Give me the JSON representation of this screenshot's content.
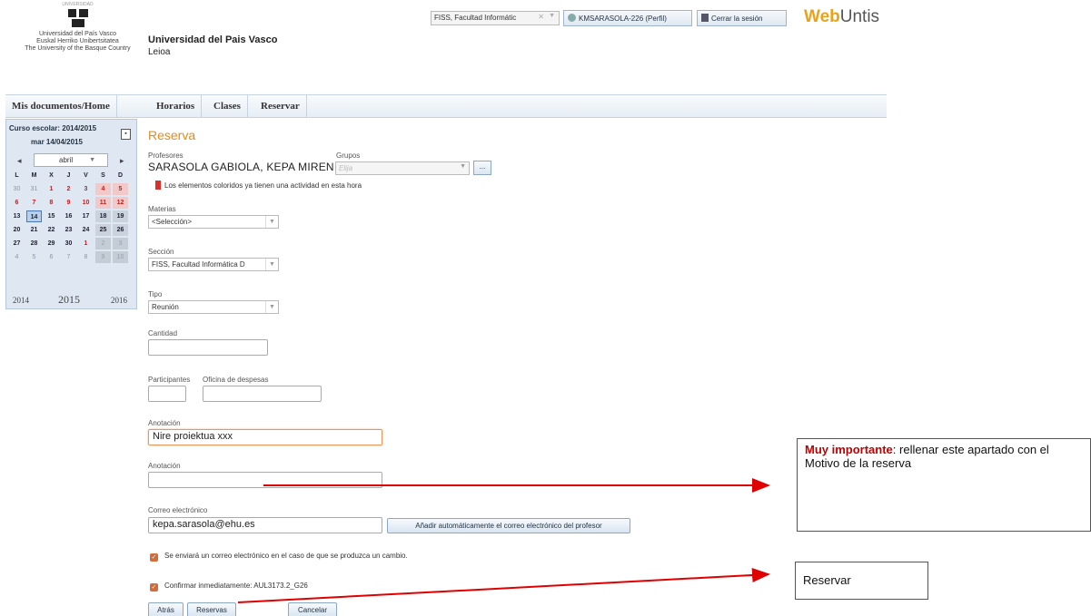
{
  "header": {
    "logo_top_text": "UNIVERSIDAD",
    "logo_lines": [
      "Universidad del País Vasco",
      "Euskal Herriko Unibertsitatea",
      "The University of the Basque Country"
    ],
    "university_name": "Universidad del Pais Vasco",
    "city": "Leioa",
    "school_select": "FISS, Facultad Informátic",
    "profile_button": "KMSARASOLA-226 (Perfil)",
    "logout_button": "Cerrar la sesión",
    "brand_web": "Web",
    "brand_untis": "Untis"
  },
  "menu": [
    "Mis documentos/Home",
    "Horarios",
    "Clases",
    "Reservar"
  ],
  "calendar": {
    "school_year": "Curso escolar: 2014/2015",
    "current_date": "mar 14/04/2015",
    "month": "abril",
    "weekdays": [
      "L",
      "M",
      "X",
      "J",
      "V",
      "S",
      "D"
    ],
    "weeks": [
      [
        "30",
        "31",
        "1",
        "2",
        "3",
        "4",
        "5"
      ],
      [
        "6",
        "7",
        "8",
        "9",
        "10",
        "11",
        "12"
      ],
      [
        "13",
        "14",
        "15",
        "16",
        "17",
        "18",
        "19"
      ],
      [
        "20",
        "21",
        "22",
        "23",
        "24",
        "25",
        "26"
      ],
      [
        "27",
        "28",
        "29",
        "30",
        "1",
        "2",
        "3"
      ],
      [
        "4",
        "5",
        "6",
        "7",
        "8",
        "9",
        "10"
      ]
    ],
    "years": [
      "2014",
      "2015",
      "2016"
    ]
  },
  "form": {
    "title": "Reserva",
    "teachers_label": "Profesores",
    "teacher_value": "SARASOLA GABIOLA, KEPA MIREN",
    "groups_label": "Grupos",
    "groups_placeholder": "Elija",
    "more_button": "...",
    "legend_text": "Los elementos coloridos ya tienen una actividad en esta hora",
    "subjects_label": "Materias",
    "subjects_value": "<Selección>",
    "section_label": "Sección",
    "section_value": "FISS, Facultad Informática D",
    "type_label": "Tipo",
    "type_value": "Reunión",
    "quantity_label": "Cantidad",
    "quantity_value": "",
    "participants_label": "Participantes",
    "participants_value": "",
    "expense_office_label": "Oficina de despesas",
    "expense_office_value": "",
    "annotation1_label": "Anotación",
    "annotation1_value": "Nire proiektua xxx",
    "annotation2_label": "Anotación",
    "annotation2_value": "",
    "email_label": "Correo electrónico",
    "email_value": "kepa.sarasola@ehu.es",
    "email_auto_button": "Añadir automáticamente el correo electrónico del profesor",
    "notify_check_text": "Se enviará un correo electrónico en el caso de que se produzca un cambio.",
    "confirm_check_text": "Confirmar inmediatamente: AUL3173.2_G26",
    "back_button": "Atrás",
    "reserve_button": "Reservas",
    "cancel_button": "Cancelar"
  },
  "annotations": {
    "note_bold": "Muy importante",
    "note_rest": ": rellenar este apartado con el Motivo de la reserva",
    "reserve_note": "Reservar",
    "arrow_color": "#e00000"
  }
}
